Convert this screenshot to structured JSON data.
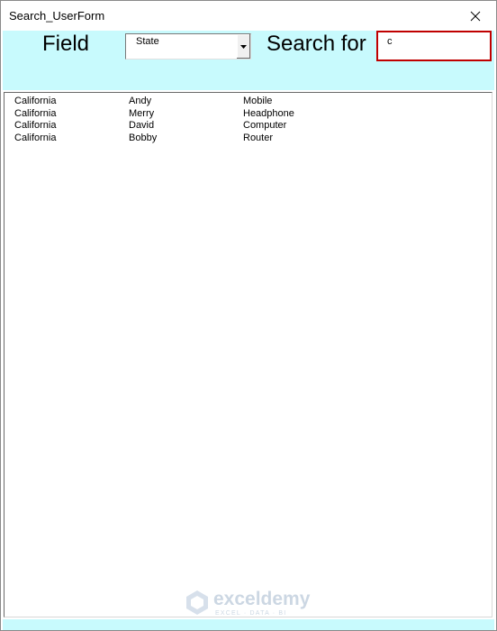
{
  "window": {
    "title": "Search_UserForm"
  },
  "header": {
    "field_label": "Field",
    "field_combo_value": "State",
    "search_label": "Search for",
    "search_value": "c",
    "panel_color": "#c8fafd",
    "search_border_color": "#c00000"
  },
  "icons": {
    "close": "close-icon",
    "dropdown": "chevron-down-icon",
    "watermark_logo": "exceldemy-logo-icon"
  },
  "results": {
    "rows": [
      [
        "California",
        "Andy",
        "Mobile"
      ],
      [
        "California",
        "Merry",
        "Headphone"
      ],
      [
        "California",
        "David",
        "Computer"
      ],
      [
        "California",
        "Bobby",
        "Router"
      ]
    ]
  },
  "watermark": {
    "brand": "exceldemy",
    "tagline": "EXCEL · DATA · BI"
  }
}
